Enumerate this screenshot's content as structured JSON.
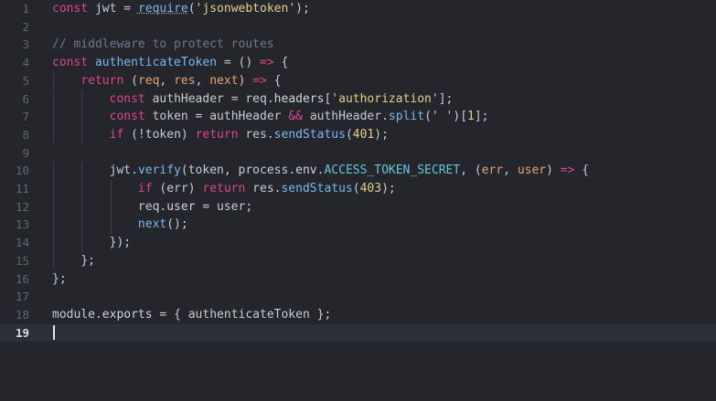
{
  "editor": {
    "lines": [
      {
        "n": "1",
        "t": [
          [
            "const",
            "kw"
          ],
          [
            " ",
            "punc"
          ],
          [
            "jwt",
            "var"
          ],
          [
            " = ",
            "punc"
          ],
          [
            "require",
            "fn dotted"
          ],
          [
            "('",
            "punc"
          ],
          [
            "jsonwebtoken",
            "str"
          ],
          [
            "');",
            "punc"
          ]
        ]
      },
      {
        "n": "2",
        "t": []
      },
      {
        "n": "3",
        "t": [
          [
            "// middleware to protect routes",
            "cm"
          ]
        ]
      },
      {
        "n": "4",
        "t": [
          [
            "const",
            "kw"
          ],
          [
            " ",
            "punc"
          ],
          [
            "authenticateToken",
            "fn"
          ],
          [
            " = () ",
            "punc"
          ],
          [
            "=>",
            "op"
          ],
          [
            " {",
            "punc"
          ]
        ]
      },
      {
        "n": "5",
        "t": [
          [
            "    ",
            "punc"
          ],
          [
            "return",
            "kw"
          ],
          [
            " (",
            "punc"
          ],
          [
            "req",
            "param"
          ],
          [
            ", ",
            "punc"
          ],
          [
            "res",
            "param"
          ],
          [
            ", ",
            "punc"
          ],
          [
            "next",
            "param"
          ],
          [
            ") ",
            "punc"
          ],
          [
            "=>",
            "op"
          ],
          [
            " {",
            "punc"
          ]
        ]
      },
      {
        "n": "6",
        "t": [
          [
            "        ",
            "punc"
          ],
          [
            "const",
            "kw"
          ],
          [
            " ",
            "punc"
          ],
          [
            "authHeader",
            "var"
          ],
          [
            " = ",
            "punc"
          ],
          [
            "req",
            "var"
          ],
          [
            ".",
            "punc"
          ],
          [
            "headers",
            "prop"
          ],
          [
            "['",
            "punc"
          ],
          [
            "authorization",
            "str"
          ],
          [
            "'];",
            "punc"
          ]
        ]
      },
      {
        "n": "7",
        "t": [
          [
            "        ",
            "punc"
          ],
          [
            "const",
            "kw"
          ],
          [
            " ",
            "punc"
          ],
          [
            "token",
            "var"
          ],
          [
            " = ",
            "punc"
          ],
          [
            "authHeader",
            "var"
          ],
          [
            " ",
            "punc"
          ],
          [
            "&&",
            "op"
          ],
          [
            " ",
            "punc"
          ],
          [
            "authHeader",
            "var"
          ],
          [
            ".",
            "punc"
          ],
          [
            "split",
            "fn"
          ],
          [
            "(' ')[",
            "punc"
          ],
          [
            "1",
            "num"
          ],
          [
            "];",
            "punc"
          ]
        ]
      },
      {
        "n": "8",
        "t": [
          [
            "        ",
            "punc"
          ],
          [
            "if",
            "kw"
          ],
          [
            " (!",
            "punc"
          ],
          [
            "token",
            "var"
          ],
          [
            ") ",
            "punc"
          ],
          [
            "return",
            "kw"
          ],
          [
            " ",
            "punc"
          ],
          [
            "res",
            "var"
          ],
          [
            ".",
            "punc"
          ],
          [
            "sendStatus",
            "fn"
          ],
          [
            "(",
            "punc"
          ],
          [
            "401",
            "num"
          ],
          [
            ");",
            "punc"
          ]
        ]
      },
      {
        "n": "9",
        "t": []
      },
      {
        "n": "10",
        "t": [
          [
            "        ",
            "punc"
          ],
          [
            "jwt",
            "var"
          ],
          [
            ".",
            "punc"
          ],
          [
            "verify",
            "fn"
          ],
          [
            "(",
            "punc"
          ],
          [
            "token",
            "var"
          ],
          [
            ", ",
            "punc"
          ],
          [
            "process",
            "var"
          ],
          [
            ".",
            "punc"
          ],
          [
            "env",
            "prop"
          ],
          [
            ".",
            "punc"
          ],
          [
            "ACCESS_TOKEN_SECRET",
            "const"
          ],
          [
            ", (",
            "punc"
          ],
          [
            "err",
            "param"
          ],
          [
            ", ",
            "punc"
          ],
          [
            "user",
            "param"
          ],
          [
            ") ",
            "punc"
          ],
          [
            "=>",
            "op"
          ],
          [
            " {",
            "punc"
          ]
        ]
      },
      {
        "n": "11",
        "t": [
          [
            "            ",
            "punc"
          ],
          [
            "if",
            "kw"
          ],
          [
            " (",
            "punc"
          ],
          [
            "err",
            "var"
          ],
          [
            ") ",
            "punc"
          ],
          [
            "return",
            "kw"
          ],
          [
            " ",
            "punc"
          ],
          [
            "res",
            "var"
          ],
          [
            ".",
            "punc"
          ],
          [
            "sendStatus",
            "fn"
          ],
          [
            "(",
            "punc"
          ],
          [
            "403",
            "num"
          ],
          [
            ");",
            "punc"
          ]
        ]
      },
      {
        "n": "12",
        "t": [
          [
            "            ",
            "punc"
          ],
          [
            "req",
            "var"
          ],
          [
            ".",
            "punc"
          ],
          [
            "user",
            "prop"
          ],
          [
            " = ",
            "punc"
          ],
          [
            "user",
            "var"
          ],
          [
            ";",
            "punc"
          ]
        ]
      },
      {
        "n": "13",
        "t": [
          [
            "            ",
            "punc"
          ],
          [
            "next",
            "fn"
          ],
          [
            "();",
            "punc"
          ]
        ]
      },
      {
        "n": "14",
        "t": [
          [
            "        ",
            "punc"
          ],
          [
            "});",
            "punc"
          ]
        ]
      },
      {
        "n": "15",
        "t": [
          [
            "    ",
            "punc"
          ],
          [
            "};",
            "punc"
          ]
        ]
      },
      {
        "n": "16",
        "t": [
          [
            "};",
            "punc"
          ]
        ]
      },
      {
        "n": "17",
        "t": []
      },
      {
        "n": "18",
        "t": [
          [
            "module",
            "var"
          ],
          [
            ".",
            "punc"
          ],
          [
            "exports",
            "prop"
          ],
          [
            " = { ",
            "punc"
          ],
          [
            "authenticateToken",
            "var"
          ],
          [
            " };",
            "punc"
          ]
        ]
      },
      {
        "n": "19",
        "t": [],
        "active": true
      }
    ]
  },
  "colors": {
    "background": "#24262c",
    "active_line": "#2c2f37",
    "keyword": "#d9478e",
    "function": "#79b7f0",
    "string": "#e1d08a",
    "comment": "#6f7786",
    "parameter": "#e8a173",
    "constant": "#62c7d9"
  }
}
